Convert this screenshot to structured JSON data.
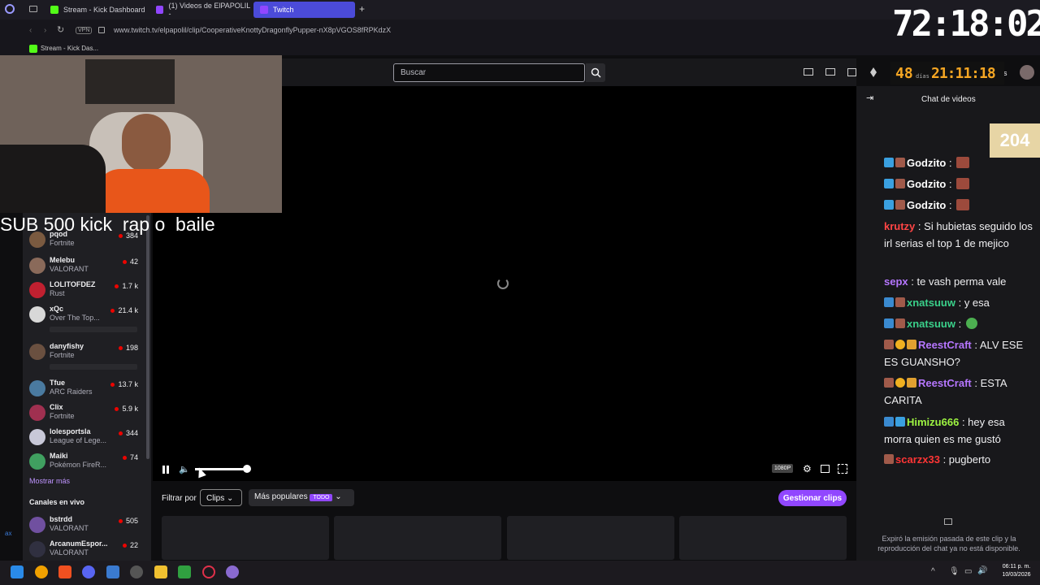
{
  "browser": {
    "tabs": [
      {
        "label": "Stream - Kick Dashboard",
        "color": "#53fc18"
      },
      {
        "label": "(1) Videos de ElPAPOLIL -",
        "color": "#9146ff"
      },
      {
        "label": "Twitch",
        "color": "#9146ff"
      }
    ],
    "vpn_label": "VPN",
    "url": "www.twitch.tv/elpapolil/clip/CooperativeKnottyDragonflyPupper-nX8pVGOS8fRPKdzX",
    "bookmark": "Stream - Kick Das..."
  },
  "twitch": {
    "search_placeholder": "Buscar",
    "top_right_partial": "os",
    "sidebar": {
      "recommended": [
        {
          "name": "pqod",
          "game": "Fortnite",
          "viewers": "384",
          "color": "#7a5a40"
        },
        {
          "name": "Melebu",
          "game": "VALORANT",
          "viewers": "42",
          "color": "#8a6a5a"
        },
        {
          "name": "LOLITOFDEZ",
          "game": "Rust",
          "viewers": "1.7 k",
          "color": "#c02030"
        },
        {
          "name": "xQc",
          "game": "Over The Top...",
          "viewers": "21.4 k",
          "color": "#d8d8d8"
        },
        {
          "name": "danyfishy",
          "game": "Fortnite",
          "viewers": "198",
          "color": "#6a5040"
        },
        {
          "name": "Tfue",
          "game": "ARC Raiders",
          "viewers": "13.7 k",
          "color": "#4a7aa0"
        },
        {
          "name": "Clix",
          "game": "Fortnite",
          "viewers": "5.9 k",
          "color": "#a03050"
        },
        {
          "name": "lolesportsla",
          "game": "League of Lege...",
          "viewers": "344",
          "color": "#c8c8d8"
        },
        {
          "name": "Maiki",
          "game": "Pokémon FireR...",
          "viewers": "74",
          "color": "#40a060"
        }
      ],
      "show_more": "Mostrar más",
      "live_header": "Canales en vivo",
      "live": [
        {
          "name": "bstrdd",
          "game": "VALORANT",
          "viewers": "505",
          "color": "#7050a0"
        },
        {
          "name": "ArcanumEspor...",
          "game": "VALORANT",
          "viewers": "22",
          "color": "#303040"
        }
      ]
    },
    "player": {
      "quality": "1080P",
      "volume": 0.5
    },
    "filter": {
      "label": "Filtrar por",
      "clips": "Clips",
      "popular": "Más populares",
      "badge": "TODO",
      "manage": "Gestionar clips"
    },
    "chat": {
      "header": "Chat de videos",
      "messages": [
        {
          "user": "Godzito",
          "color": "#ffffff",
          "text": ":"
        },
        {
          "user": "Godzito",
          "color": "#ffffff",
          "text": ":"
        },
        {
          "user": "Godzito",
          "color": "#ffffff",
          "text": ":"
        },
        {
          "user": "krutzy",
          "color": "#ff4545",
          "text": ": Si hubietas seguido los irl serias el top 1 de mejico"
        },
        {
          "user": "sepx",
          "color": "#b676ff",
          "text": ": te vash perma vale"
        },
        {
          "user": "xnatsuuw",
          "color": "#3ad08a",
          "text": ": y esa"
        },
        {
          "user": "xnatsuuw",
          "color": "#3ad08a",
          "text": ":"
        },
        {
          "user": "ReestCraft",
          "color": "#b676ff",
          "text": ": ALV ESE ES GUANSHO?"
        },
        {
          "user": "ReestCraft",
          "color": "#b676ff",
          "text": ": ESTA CARITA"
        },
        {
          "user": "Himizu666",
          "color": "#9ef542",
          "text": ": hey esa morra quien es me gustó"
        },
        {
          "user": "scarzx33",
          "color": "#ff3535",
          "text": ": pugberto"
        }
      ],
      "footer": "Expiró la emisión pasada de este clip y la reproducción del chat ya no está disponible."
    }
  },
  "overlay": {
    "timer": "72:18:02",
    "days_value": "48",
    "days_label": "días",
    "days_clock": "21:11:18",
    "sub_count": "204",
    "banner": "SUB 500 kick  rap o  baile"
  },
  "taskbar": {
    "time": "06:11 p. m.",
    "date": "10/03/2026"
  }
}
